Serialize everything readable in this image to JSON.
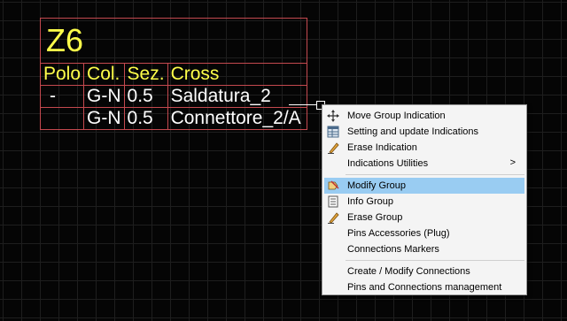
{
  "cad": {
    "title": "Z6",
    "headers": [
      "Polo",
      "Col.",
      "Sez.",
      "Cross"
    ],
    "rows": [
      [
        "-",
        "G-N",
        "0.5",
        "Saldatura_2"
      ],
      [
        "",
        "G-N",
        "0.5",
        "Connettore_2/A"
      ]
    ],
    "colors": {
      "border": "#c4494f",
      "header_text": "#ffff4a",
      "body_text": "#ffffff",
      "background": "#050505"
    }
  },
  "menu": {
    "items": [
      {
        "label": "Move Group Indication",
        "icon": "move-arrows-icon"
      },
      {
        "label": "Setting and update Indications",
        "icon": "settings-table-icon"
      },
      {
        "label": "Erase Indication",
        "icon": "eraser-icon"
      },
      {
        "label": "Indications Utilities",
        "icon": "",
        "submenu_arrow": ">"
      },
      {
        "label": "Modify Group",
        "icon": "modify-group-icon",
        "highlighted": true
      },
      {
        "label": "Info Group",
        "icon": "info-document-icon"
      },
      {
        "label": "Erase Group",
        "icon": "eraser-icon"
      },
      {
        "label": "Pins Accessories (Plug)",
        "icon": ""
      },
      {
        "label": "Connections Markers",
        "icon": ""
      },
      {
        "label": "Create / Modify Connections",
        "icon": ""
      },
      {
        "label": "Pins and Connections management",
        "icon": ""
      }
    ],
    "highlight_color": "#99ccf2"
  }
}
